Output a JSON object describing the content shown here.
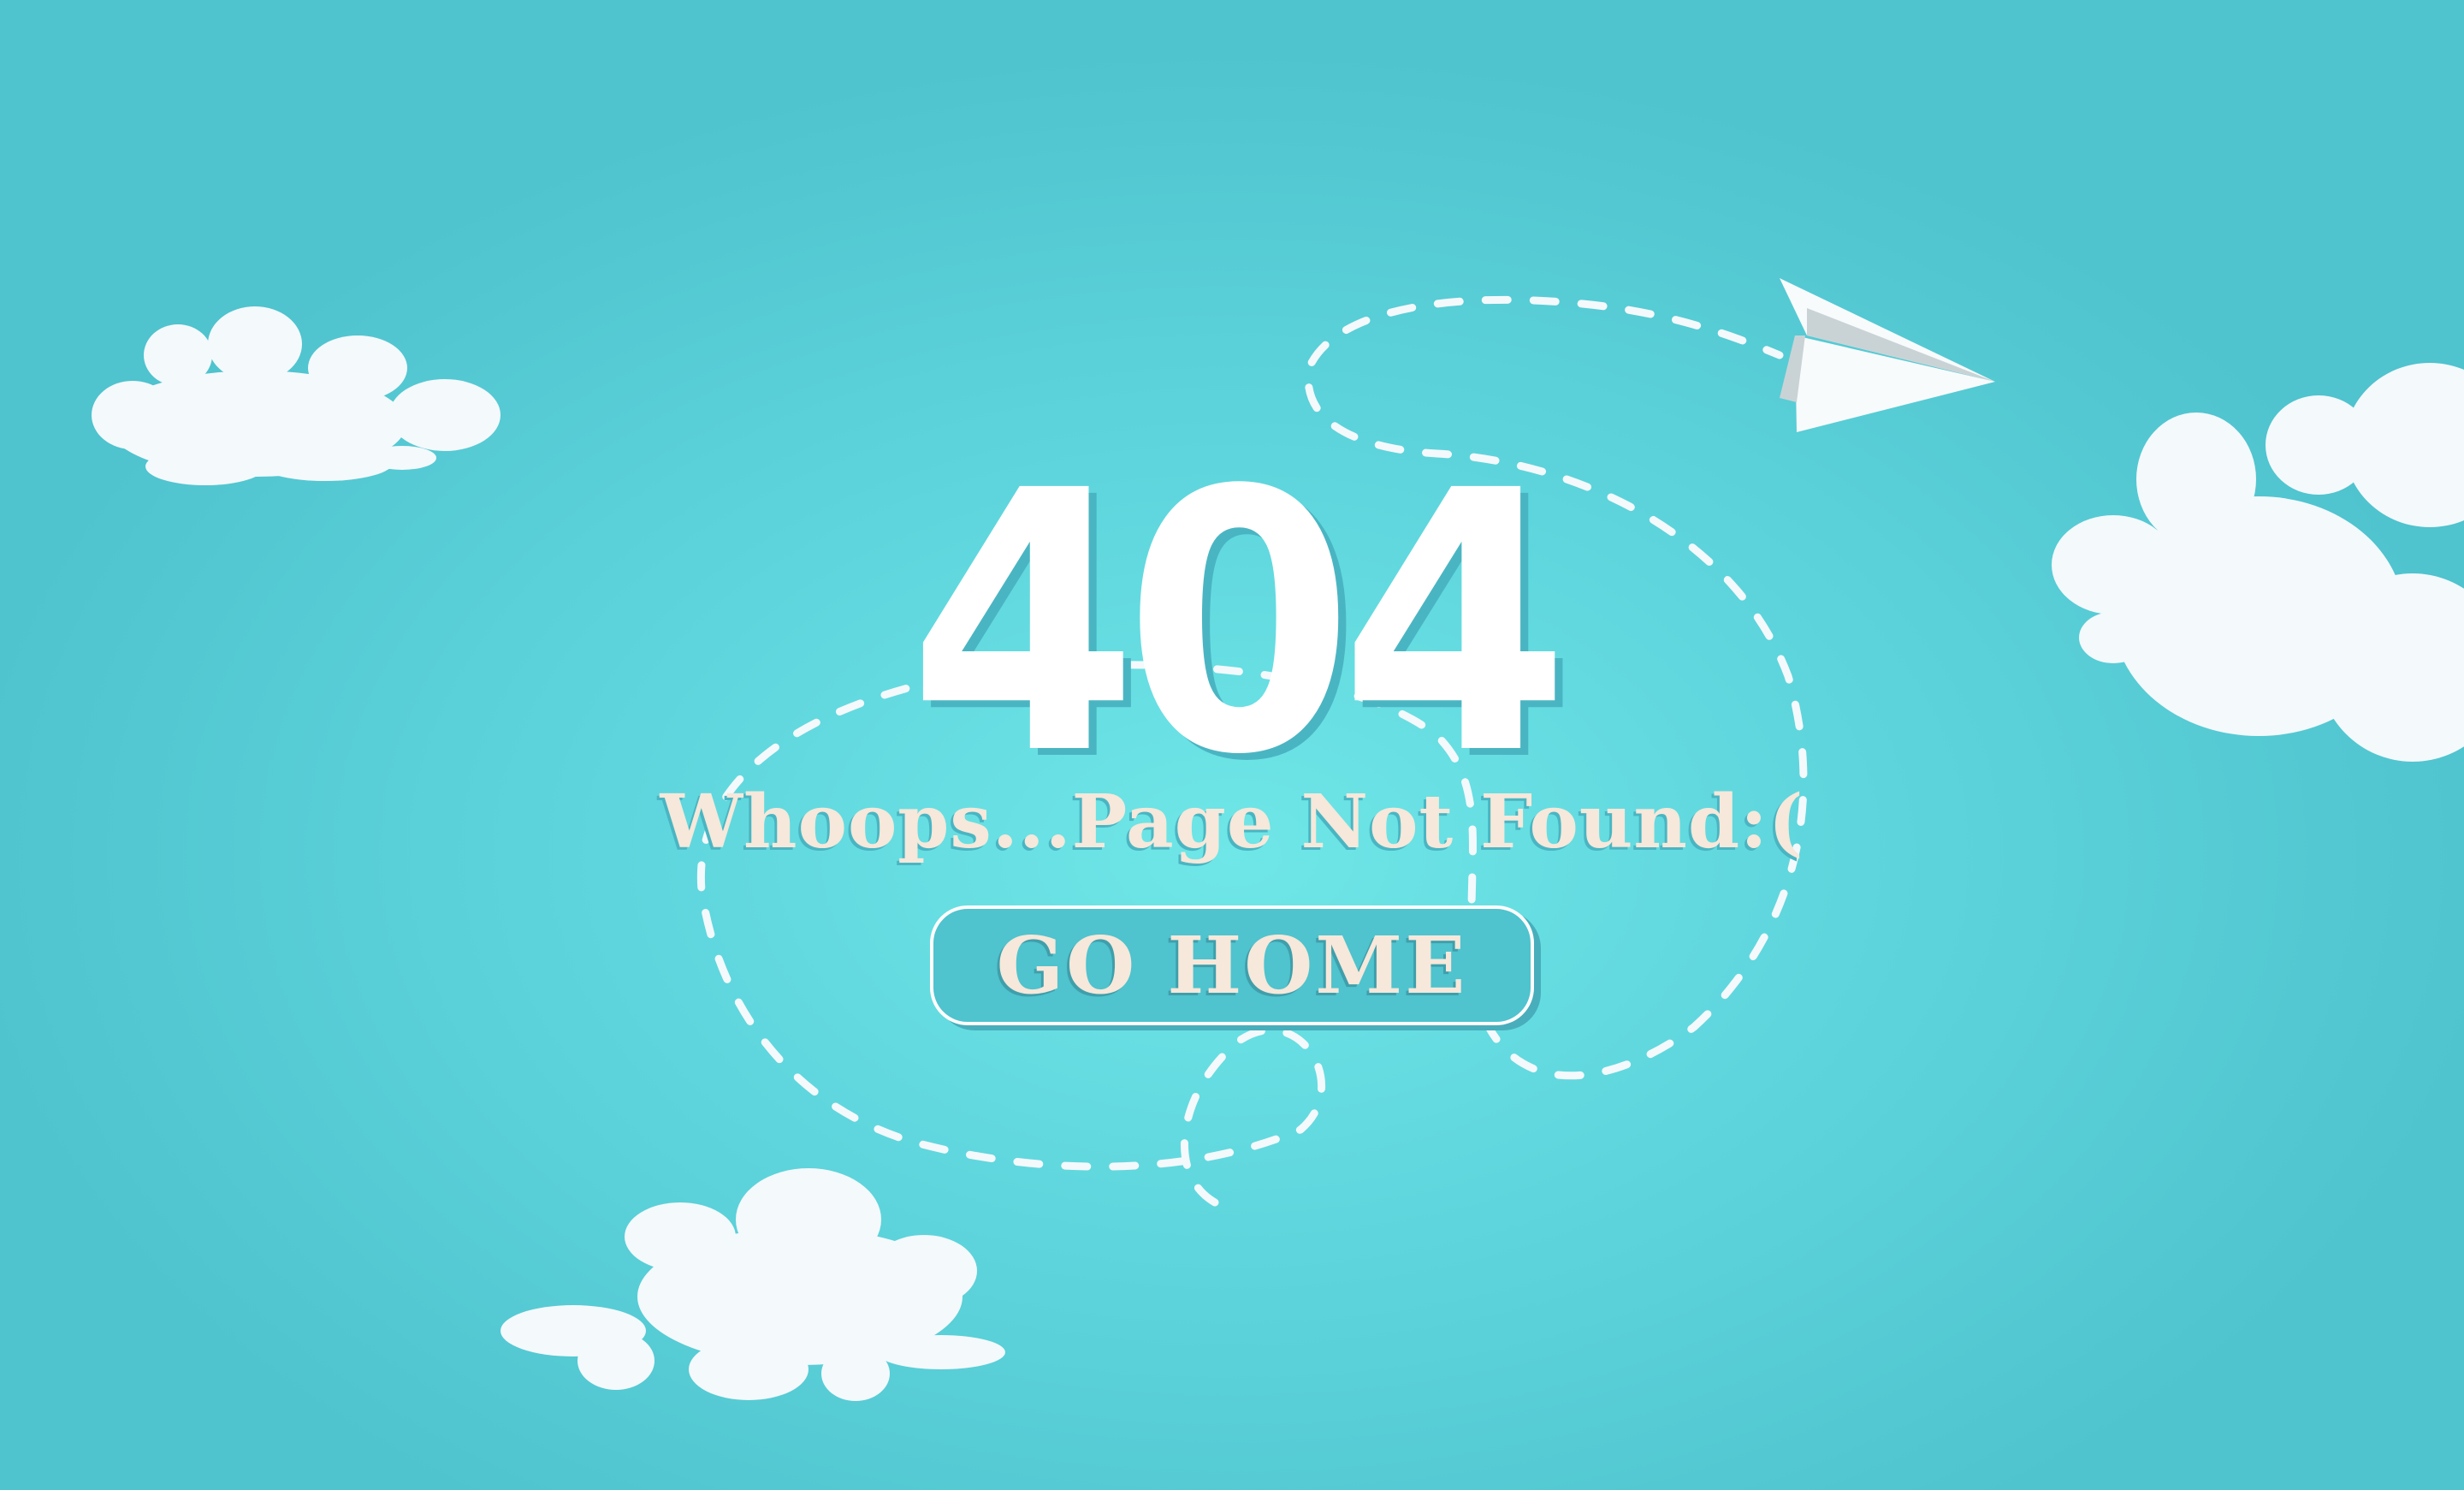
{
  "page": {
    "error_code": "404",
    "message": "Whoops...Page Not Found:(",
    "home_button_label": "GO HOME"
  },
  "colors": {
    "background": "#5fd6dd",
    "cloud": "#f4f9fc",
    "text_accent": "#f6e8da",
    "button_fill": "#4fc3ce",
    "shadow": "#4ab5c2"
  },
  "icons": {
    "plane": "paper-plane-icon",
    "cloud": "cloud-icon"
  }
}
